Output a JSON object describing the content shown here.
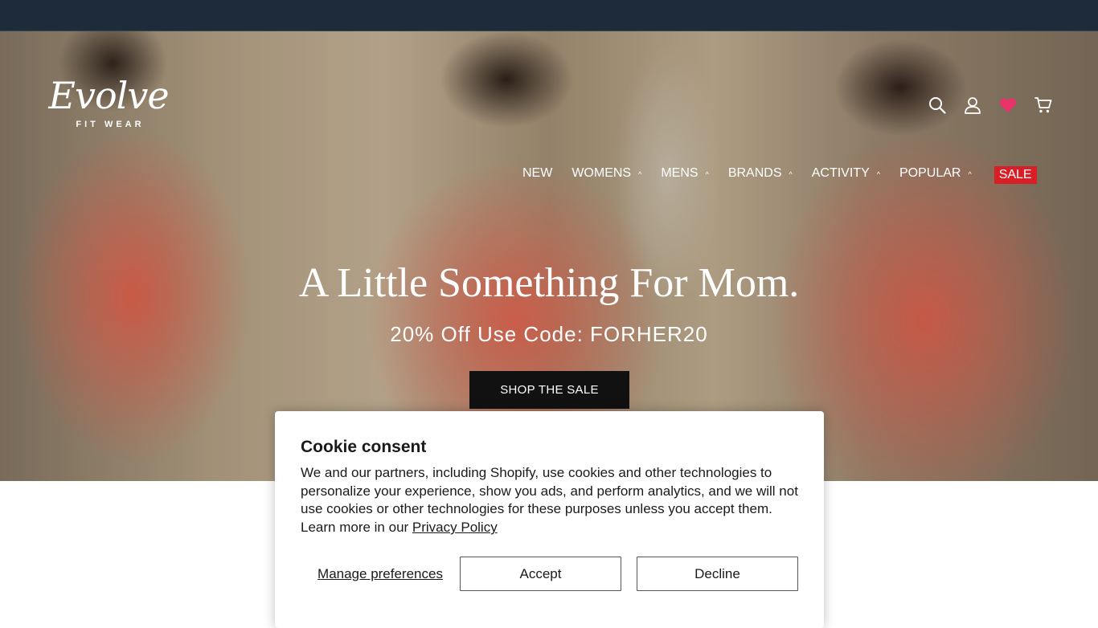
{
  "brand": {
    "logo_script": "Evolve",
    "logo_sub": "FIT WEAR"
  },
  "header": {
    "icons": [
      "search-icon",
      "account-icon",
      "wishlist-heart-icon",
      "cart-icon"
    ],
    "wishlist_color": "#e8336b"
  },
  "nav": {
    "items": [
      {
        "label": "NEW",
        "has_dropdown": false
      },
      {
        "label": "WOMENS",
        "has_dropdown": true
      },
      {
        "label": "MENS",
        "has_dropdown": true
      },
      {
        "label": "BRANDS",
        "has_dropdown": true
      },
      {
        "label": "ACTIVITY",
        "has_dropdown": true
      },
      {
        "label": "POPULAR",
        "has_dropdown": true
      }
    ],
    "sale_label": "SALE",
    "sale_color": "#d81f26",
    "chevron_glyph": "^"
  },
  "hero": {
    "title": "A Little Something For Mom.",
    "subtitle": "20% Off Use Code: FORHER20",
    "cta_label": "SHOP THE SALE"
  },
  "cookie": {
    "title": "Cookie consent",
    "body": "We and our partners, including Shopify, use cookies and other technologies to personalize your experience, show you ads, and perform analytics, and we will not use cookies or other technologies for these purposes unless you accept them. Learn more in our ",
    "privacy_link": "Privacy Policy",
    "manage_label": "Manage preferences",
    "accept_label": "Accept",
    "decline_label": "Decline"
  },
  "colors": {
    "announcement_bar": "#1d2b3a",
    "cta_background": "#111111"
  }
}
